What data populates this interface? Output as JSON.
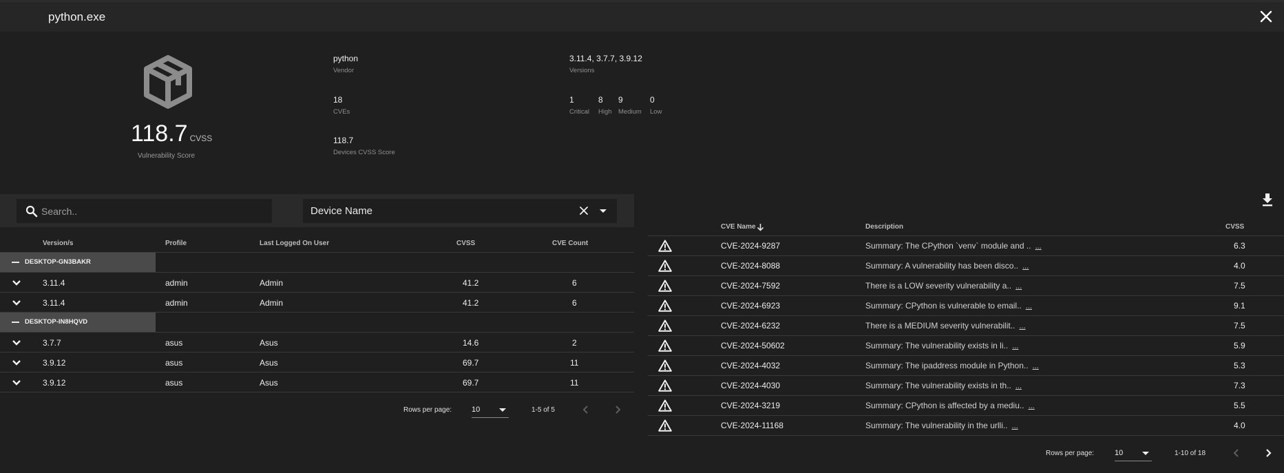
{
  "window": {
    "title": "python.exe"
  },
  "summary": {
    "score": "118.7",
    "score_unit": "CVSS",
    "score_label": "Vulnerability Score",
    "vendor": "python",
    "vendor_label": "Vendor",
    "versions": "3.11.4, 3.7.7, 3.9.12",
    "versions_label": "Versions",
    "cves": "18",
    "cves_label": "CVEs",
    "devices_score": "118.7",
    "devices_score_label": "Devices CVSS Score",
    "severity": {
      "critical": "1",
      "critical_label": "Critical",
      "high": "8",
      "high_label": "High",
      "medium": "9",
      "medium_label": "Medium",
      "low": "0",
      "low_label": "Low"
    }
  },
  "filters": {
    "search_placeholder": "Search..",
    "select_value": "Device Name"
  },
  "left_table": {
    "headers": {
      "version": "Version/s",
      "profile": "Profile",
      "user": "Last Logged On User",
      "cvss": "CVSS",
      "count": "CVE Count"
    },
    "groups": [
      {
        "name": "DESKTOP-GN3BAKR",
        "rows": [
          {
            "version": "3.11.4",
            "profile": "admin",
            "user": "Admin",
            "cvss": "41.2",
            "count": "6"
          },
          {
            "version": "3.11.4",
            "profile": "admin",
            "user": "Admin",
            "cvss": "41.2",
            "count": "6"
          }
        ]
      },
      {
        "name": "DESKTOP-IN8HQVD",
        "rows": [
          {
            "version": "3.7.7",
            "profile": "asus",
            "user": "Asus",
            "cvss": "14.6",
            "count": "2"
          },
          {
            "version": "3.9.12",
            "profile": "asus",
            "user": "Asus",
            "cvss": "69.7",
            "count": "11"
          },
          {
            "version": "3.9.12",
            "profile": "asus",
            "user": "Asus",
            "cvss": "69.7",
            "count": "11"
          }
        ]
      }
    ],
    "pagination": {
      "rows_label": "Rows per page:",
      "rows_value": "10",
      "range": "1-5 of 5"
    }
  },
  "right_table": {
    "headers": {
      "name": "CVE Name",
      "description": "Description",
      "cvss": "CVSS"
    },
    "more_label": "...",
    "rows": [
      {
        "name": "CVE-2024-9287",
        "description": "Summary: The CPython `venv` module and ..",
        "cvss": "6.3"
      },
      {
        "name": "CVE-2024-8088",
        "description": "Summary: A vulnerability has been disco..",
        "cvss": "4.0"
      },
      {
        "name": "CVE-2024-7592",
        "description": "There is a LOW severity vulnerability a..",
        "cvss": "7.5"
      },
      {
        "name": "CVE-2024-6923",
        "description": "Summary: CPython is vulnerable to email..",
        "cvss": "9.1"
      },
      {
        "name": "CVE-2024-6232",
        "description": "There is a MEDIUM severity vulnerabilit..",
        "cvss": "7.5"
      },
      {
        "name": "CVE-2024-50602",
        "description": "Summary: The vulnerability exists in li..",
        "cvss": "5.9"
      },
      {
        "name": "CVE-2024-4032",
        "description": "Summary: The ipaddress module in Python..",
        "cvss": "5.3"
      },
      {
        "name": "CVE-2024-4030",
        "description": "Summary: The vulnerability exists in th..",
        "cvss": "7.3"
      },
      {
        "name": "CVE-2024-3219",
        "description": "Summary: CPython is affected by a mediu..",
        "cvss": "5.5"
      },
      {
        "name": "CVE-2024-11168",
        "description": "Summary: The vulnerability in the urlli..",
        "cvss": "4.0"
      }
    ],
    "pagination": {
      "rows_label": "Rows per page:",
      "rows_value": "10",
      "range": "1-10 of 18"
    }
  },
  "colors": {
    "background": "#1f1f1f",
    "group_row": "#4a4a4a",
    "icon_gray": "#8c8c8c"
  }
}
